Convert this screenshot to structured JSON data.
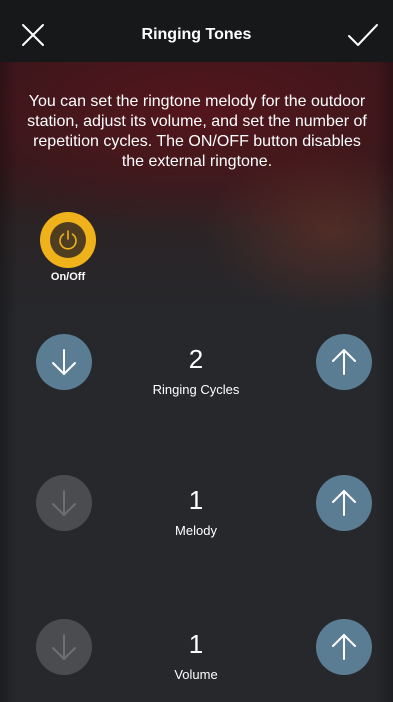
{
  "header": {
    "title": "Ringing Tones",
    "close_icon": "close-icon",
    "confirm_icon": "checkmark-icon"
  },
  "description": "You can set the ringtone melody for the outdoor station, adjust its volume, and set the number of repetition cycles. The ON/OFF button disables the external ringtone.",
  "power_toggle": {
    "label": "On/Off",
    "icon": "power-icon",
    "state": "on",
    "color": "#f0b21b"
  },
  "settings": [
    {
      "label": "Ringing Cycles",
      "value": "2",
      "decrement_enabled": true,
      "increment_enabled": true
    },
    {
      "label": "Melody",
      "value": "1",
      "decrement_enabled": false,
      "increment_enabled": true
    },
    {
      "label": "Volume",
      "value": "1",
      "decrement_enabled": false,
      "increment_enabled": true
    }
  ],
  "colors": {
    "accent": "#5b7d94",
    "disabled": "#4b4c50",
    "header": "#17181a"
  }
}
